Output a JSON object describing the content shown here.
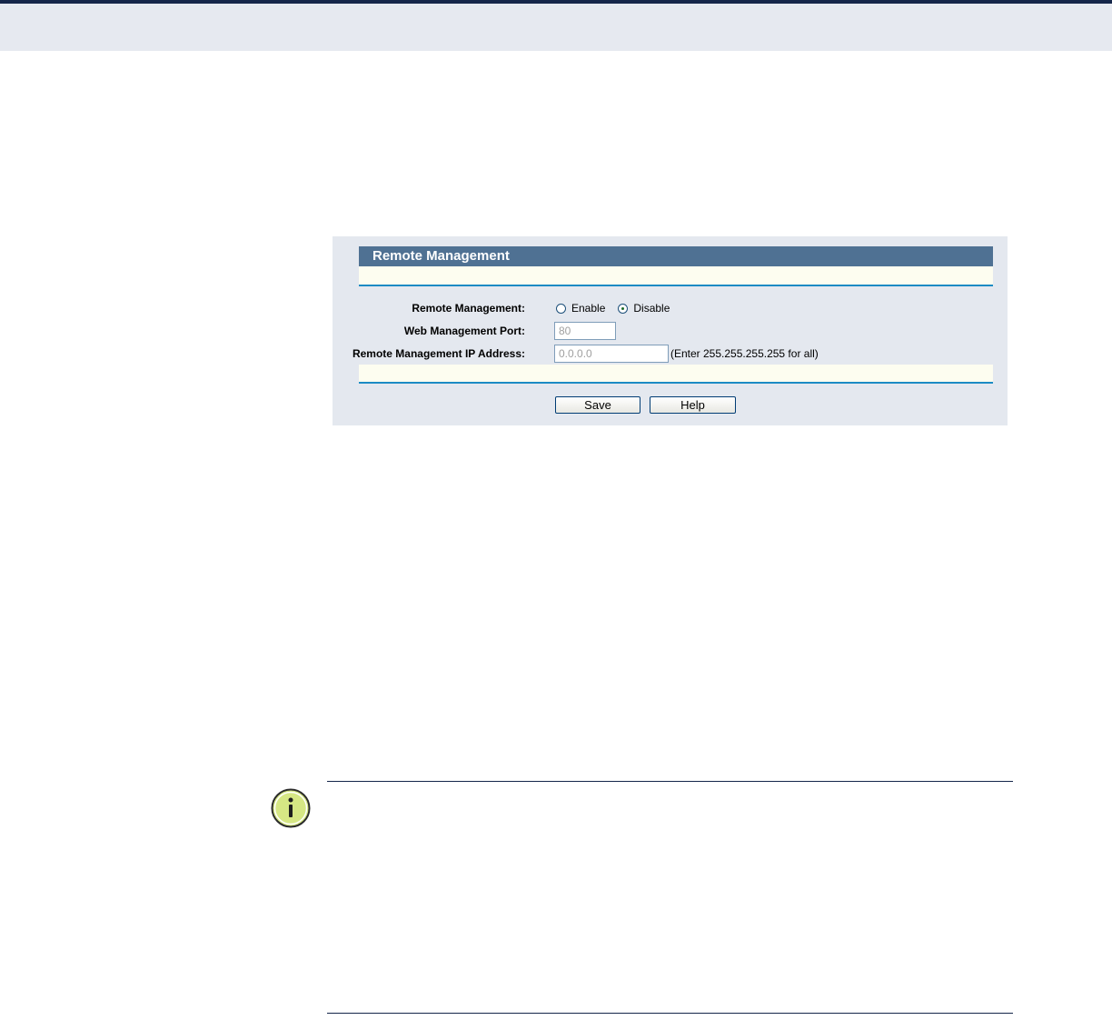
{
  "panel": {
    "title": "Remote Management",
    "remote_management": {
      "label": "Remote Management:",
      "options": [
        "Enable",
        "Disable"
      ],
      "selected": "Disable"
    },
    "port": {
      "label": "Web Management Port:",
      "value": "80"
    },
    "ip": {
      "label": "Remote Management IP Address:",
      "value": "0.0.0.0",
      "hint": "(Enter 255.255.255.255 for all)"
    },
    "buttons": {
      "save": "Save",
      "help": "Help"
    }
  },
  "note": {
    "icon": "info-icon"
  },
  "colors": {
    "header": "#4f7193",
    "panel_bg": "#e4e8ef",
    "cream": "#fdfdf0",
    "rule_blue": "#1c8bc4",
    "page_band": "#e6e9f0",
    "dark_navy": "#15264a",
    "info_green": "#d6e784"
  }
}
